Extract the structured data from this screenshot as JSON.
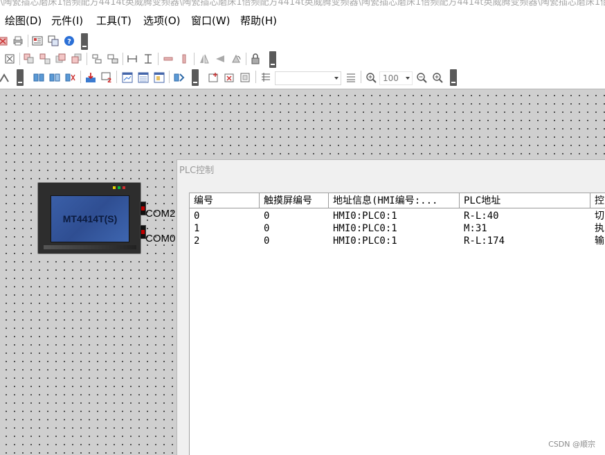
{
  "window": {
    "title": "\\陶瓷插芯磨床1倍频配方4414t英威腾变频器\\陶瓷插芯磨床1倍频配方4414t英威腾变频器\\陶瓷插芯磨床1倍频配方4414t英威腾变频器\\陶瓷插芯磨床1倍频配方4414t英威腾变频器"
  },
  "menu": [
    {
      "label": "绘图(D)"
    },
    {
      "label": "元件(I)"
    },
    {
      "label": "工具(T)"
    },
    {
      "label": "选项(O)"
    },
    {
      "label": "窗口(W)"
    },
    {
      "label": "帮助(H)"
    }
  ],
  "toolbar3": {
    "font_combo_value": "",
    "zoom_value": "100"
  },
  "device": {
    "model_label": "MT4414T(S)",
    "ports": [
      "COM2",
      "COM0"
    ],
    "led_colors": [
      "#e8d000",
      "#00c040",
      "#d03030"
    ]
  },
  "plc_dialog": {
    "title": "PLC控制",
    "columns": [
      "编号",
      "触摸屏编号",
      "地址信息(HMI编号:...",
      "PLC地址",
      "控"
    ],
    "rows": [
      [
        "0",
        "0",
        "HMI0:PLC0:1",
        "R-L:40",
        "切"
      ],
      [
        "1",
        "0",
        "HMI0:PLC0:1",
        "M:31",
        "执"
      ],
      [
        "2",
        "0",
        "HMI0:PLC0:1",
        "R-L:174",
        "输"
      ]
    ]
  },
  "watermark": "CSDN @顺宗",
  "colors": {
    "canvas_bg": "#cfcfcf",
    "screen_blue": "#3a5fa8",
    "port_red": "#c00000"
  }
}
